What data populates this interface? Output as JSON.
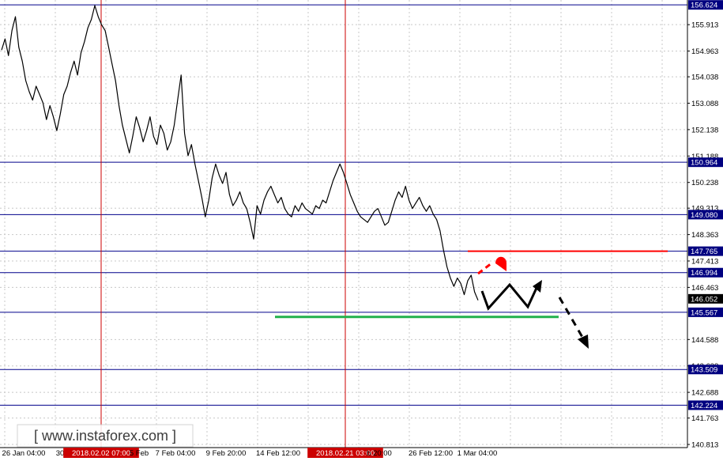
{
  "chart_data": {
    "type": "line",
    "title": "",
    "xlabel": "",
    "ylabel": "",
    "ylim": [
      140.7,
      156.8
    ],
    "grid": true,
    "series": [
      {
        "values": [
          155.0,
          155.4,
          154.8,
          155.7,
          156.2,
          155.1,
          154.6,
          153.9,
          153.5,
          153.2,
          153.7,
          153.4,
          153.1,
          152.5,
          153.0,
          152.6,
          152.1,
          152.7,
          153.4,
          153.7,
          154.2,
          154.6,
          154.1,
          154.9,
          155.3,
          155.8,
          156.1,
          156.6,
          156.2,
          155.9,
          155.7,
          155.1,
          154.5,
          153.9,
          153.0,
          152.3,
          151.8,
          151.3,
          151.9,
          152.6,
          152.2,
          151.7,
          152.1,
          152.6,
          151.9,
          151.6,
          152.3,
          152.0,
          151.4,
          151.7,
          152.3,
          153.2,
          154.1,
          152.0,
          151.2,
          151.6,
          150.9,
          150.3,
          149.7,
          149.0,
          149.6,
          150.4,
          150.9,
          150.5,
          150.2,
          150.6,
          149.8,
          149.4,
          149.6,
          149.9,
          149.5,
          149.3,
          148.8,
          148.2,
          149.4,
          149.1,
          149.6,
          149.9,
          150.1,
          149.8,
          149.5,
          149.7,
          149.3,
          149.1,
          149.0,
          149.4,
          149.2,
          149.5,
          149.3,
          149.2,
          149.1,
          149.4,
          149.3,
          149.6,
          149.5,
          149.9,
          150.3,
          150.6,
          150.9,
          150.6,
          150.2,
          149.8,
          149.5,
          149.2,
          149.0,
          148.9,
          148.8,
          149.0,
          149.2,
          149.3,
          149.0,
          148.7,
          148.8,
          149.2,
          149.6,
          149.9,
          149.7,
          150.1,
          149.6,
          149.3,
          149.5,
          149.7,
          149.4,
          149.2,
          149.4,
          149.1,
          148.9,
          148.5,
          147.8,
          147.2,
          146.8,
          146.5,
          146.8,
          146.6,
          146.2,
          146.7,
          146.9,
          146.3,
          146.0
        ]
      }
    ],
    "x_tick_labels": [
      "26 Jan 04:00",
      "30 Jan",
      "2018.02.02 07:00",
      "5 Feb",
      "7 Feb 04:00",
      "9 Feb 20:00",
      "14 Feb 12:00",
      "1",
      "2018.02.21 03:00",
      "b 20:00",
      "26 Feb 12:00",
      "1 Mar 04:00"
    ],
    "y_tick_labels": [
      "155.913",
      "154.963",
      "154.038",
      "153.088",
      "152.138",
      "151.188",
      "150.238",
      "149.313",
      "148.363",
      "147.413",
      "146.463",
      "144.588",
      "143.638",
      "142.688",
      "141.763",
      "140.813"
    ],
    "levels": [
      {
        "value": 156.624,
        "label": "156.624"
      },
      {
        "value": 150.964,
        "label": "150.964"
      },
      {
        "value": 149.08,
        "label": "149.080"
      },
      {
        "value": 147.765,
        "label": "147.765"
      },
      {
        "value": 146.994,
        "label": "146.994"
      },
      {
        "value": 145.567,
        "label": "145.567"
      },
      {
        "value": 143.509,
        "label": "143.509"
      },
      {
        "value": 142.224,
        "label": "142.224"
      }
    ],
    "current_price": "146.052",
    "vertical_markers": [
      "2018.02.02 07:00",
      "2018.02.21 03:00"
    ],
    "resistance": 147.765,
    "support": 145.4,
    "colors": {
      "price_line": "#000000",
      "level_line": "#00008b",
      "marker_line": "#cc0000",
      "resistance_line": "#ff0000",
      "support_line": "#22b14c",
      "tag_bg": "#000080",
      "marker_tag_bg": "#cc0000",
      "grid": "#c8c8c8",
      "arrow": "#000000",
      "red_arrow": "#ff0000"
    }
  },
  "watermark": {
    "text": "[ www.instaforex.com ]"
  }
}
